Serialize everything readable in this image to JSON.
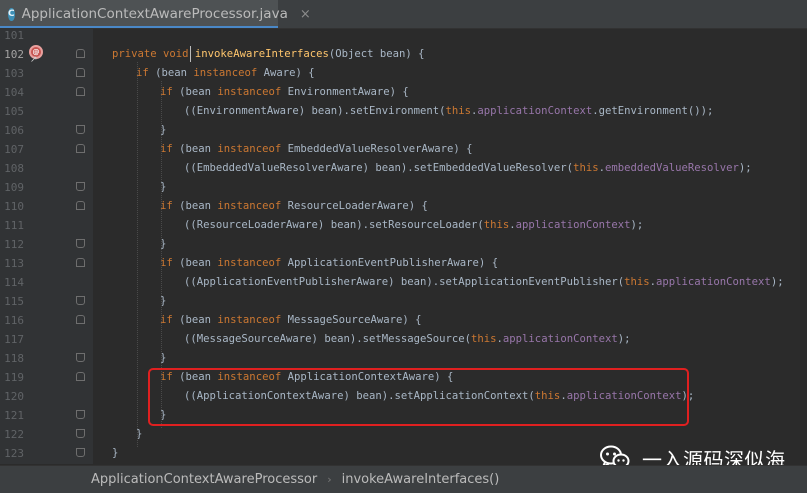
{
  "tab": {
    "icon": "class-c-icon",
    "icon_letter": "C",
    "title": "ApplicationContextAwareProcessor.java",
    "close": "×"
  },
  "lines": [
    {
      "num": "101",
      "indent": 0,
      "tokens": []
    },
    {
      "num": "102",
      "indent": 1,
      "tokens": [
        [
          "kw",
          "private void "
        ],
        [
          "mth",
          "invokeAwareInterfaces"
        ],
        [
          "t",
          "(Object bean) {"
        ]
      ]
    },
    {
      "num": "103",
      "indent": 2,
      "tokens": [
        [
          "kw",
          "if "
        ],
        [
          "t",
          "(bean "
        ],
        [
          "kw",
          "instanceof "
        ],
        [
          "t",
          "Aware) {"
        ]
      ]
    },
    {
      "num": "104",
      "indent": 3,
      "tokens": [
        [
          "kw",
          "if "
        ],
        [
          "t",
          "(bean "
        ],
        [
          "kw",
          "instanceof "
        ],
        [
          "t",
          "EnvironmentAware) {"
        ]
      ]
    },
    {
      "num": "105",
      "indent": 4,
      "tokens": [
        [
          "t",
          "((EnvironmentAware) bean).setEnvironment("
        ],
        [
          "kw",
          "this"
        ],
        [
          "t",
          "."
        ],
        [
          "fld",
          "applicationContext"
        ],
        [
          "t",
          ".getEnvironment());"
        ]
      ]
    },
    {
      "num": "106",
      "indent": 3,
      "tokens": [
        [
          "t",
          "}"
        ]
      ]
    },
    {
      "num": "107",
      "indent": 3,
      "tokens": [
        [
          "kw",
          "if "
        ],
        [
          "t",
          "(bean "
        ],
        [
          "kw",
          "instanceof "
        ],
        [
          "t",
          "EmbeddedValueResolverAware) {"
        ]
      ]
    },
    {
      "num": "108",
      "indent": 4,
      "tokens": [
        [
          "t",
          "((EmbeddedValueResolverAware) bean).setEmbeddedValueResolver("
        ],
        [
          "kw",
          "this"
        ],
        [
          "t",
          "."
        ],
        [
          "fld",
          "embeddedValueResolver"
        ],
        [
          "t",
          ");"
        ]
      ]
    },
    {
      "num": "109",
      "indent": 3,
      "tokens": [
        [
          "t",
          "}"
        ]
      ]
    },
    {
      "num": "110",
      "indent": 3,
      "tokens": [
        [
          "kw",
          "if "
        ],
        [
          "t",
          "(bean "
        ],
        [
          "kw",
          "instanceof "
        ],
        [
          "t",
          "ResourceLoaderAware) {"
        ]
      ]
    },
    {
      "num": "111",
      "indent": 4,
      "tokens": [
        [
          "t",
          "((ResourceLoaderAware) bean).setResourceLoader("
        ],
        [
          "kw",
          "this"
        ],
        [
          "t",
          "."
        ],
        [
          "fld",
          "applicationContext"
        ],
        [
          "t",
          ");"
        ]
      ]
    },
    {
      "num": "112",
      "indent": 3,
      "tokens": [
        [
          "t",
          "}"
        ]
      ]
    },
    {
      "num": "113",
      "indent": 3,
      "tokens": [
        [
          "kw",
          "if "
        ],
        [
          "t",
          "(bean "
        ],
        [
          "kw",
          "instanceof "
        ],
        [
          "t",
          "ApplicationEventPublisherAware) {"
        ]
      ]
    },
    {
      "num": "114",
      "indent": 4,
      "tokens": [
        [
          "t",
          "((ApplicationEventPublisherAware) bean).setApplicationEventPublisher("
        ],
        [
          "kw",
          "this"
        ],
        [
          "t",
          "."
        ],
        [
          "fld",
          "applicationContext"
        ],
        [
          "t",
          ");"
        ]
      ]
    },
    {
      "num": "115",
      "indent": 3,
      "tokens": [
        [
          "t",
          "}"
        ]
      ]
    },
    {
      "num": "116",
      "indent": 3,
      "tokens": [
        [
          "kw",
          "if "
        ],
        [
          "t",
          "(bean "
        ],
        [
          "kw",
          "instanceof "
        ],
        [
          "t",
          "MessageSourceAware) {"
        ]
      ]
    },
    {
      "num": "117",
      "indent": 4,
      "tokens": [
        [
          "t",
          "((MessageSourceAware) bean).setMessageSource("
        ],
        [
          "kw",
          "this"
        ],
        [
          "t",
          "."
        ],
        [
          "fld",
          "applicationContext"
        ],
        [
          "t",
          ");"
        ]
      ]
    },
    {
      "num": "118",
      "indent": 3,
      "tokens": [
        [
          "t",
          "}"
        ]
      ]
    },
    {
      "num": "119",
      "indent": 3,
      "tokens": [
        [
          "kw",
          "if "
        ],
        [
          "t",
          "(bean "
        ],
        [
          "kw",
          "instanceof "
        ],
        [
          "t",
          "ApplicationContextAware) {"
        ]
      ]
    },
    {
      "num": "120",
      "indent": 4,
      "tokens": [
        [
          "t",
          "((ApplicationContextAware) bean).setApplicationContext("
        ],
        [
          "kw",
          "this"
        ],
        [
          "t",
          "."
        ],
        [
          "fld",
          "applicationContext"
        ],
        [
          "t",
          ");"
        ]
      ]
    },
    {
      "num": "121",
      "indent": 3,
      "tokens": [
        [
          "t",
          "}"
        ]
      ]
    },
    {
      "num": "122",
      "indent": 2,
      "tokens": [
        [
          "t",
          "}"
        ]
      ]
    },
    {
      "num": "123",
      "indent": 1,
      "tokens": [
        [
          "t",
          "}"
        ]
      ]
    }
  ],
  "current_line": "102",
  "breadcrumb": {
    "class_name": "ApplicationContextAwareProcessor",
    "separator": "›",
    "method_name": "invokeAwareInterfaces()"
  },
  "watermark": {
    "icon": "wechat-icon",
    "text": "一入源码深似海"
  },
  "colors": {
    "keyword": "#cc7832",
    "field": "#9876aa",
    "method": "#ffc66d",
    "text": "#a9b7c6",
    "highlight_box": "#e02020"
  }
}
